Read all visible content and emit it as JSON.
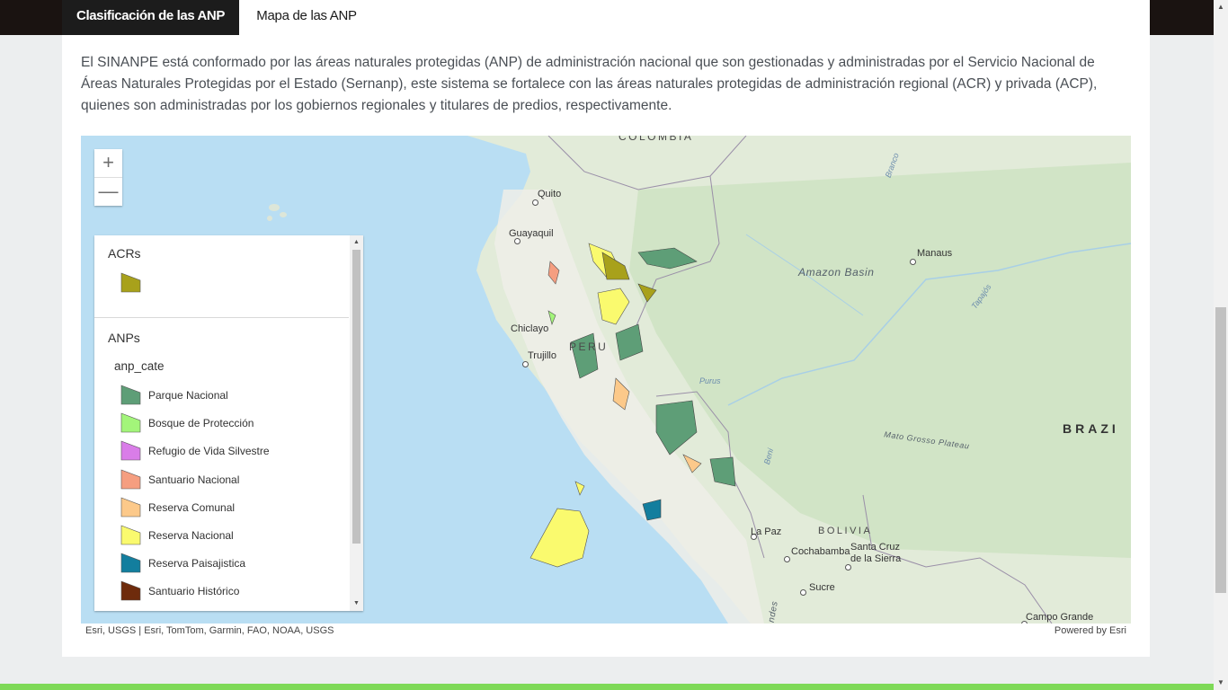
{
  "tabs": [
    {
      "label": "Clasificación de las ANP",
      "active": true
    },
    {
      "label": "Mapa de las ANP",
      "active": false
    }
  ],
  "intro_text": "El SINANPE está conformado por las áreas naturales protegidas (ANP) de administración nacional que son gestionadas y administradas por el Servicio Nacional de Áreas Naturales Protegidas por el Estado (Sernanp), este sistema se fortalece con las áreas naturales protegidas de administración regional (ACR) y privada (ACP), quienes son administradas por los gobiernos regionales y titulares de predios, respectivamente.",
  "map": {
    "zoom_in": "+",
    "zoom_out": "—",
    "labels": {
      "colombia": "COLOMBIA",
      "quito": "Quito",
      "guayaquil": "Guayaquil",
      "chiclayo": "Chiclayo",
      "trujillo": "Trujillo",
      "peru": "PERU",
      "manaus": "Manaus",
      "amazon_basin": "Amazon Basin",
      "brazil": "BRAZI",
      "mato_grosso": "Mato Grosso Plateau",
      "bolivia": "BOLIVIA",
      "la_paz": "La Paz",
      "cochabamba": "Cochabamba",
      "santa_cruz": "Santa Cruz\nde la Sierra",
      "sucre": "Sucre",
      "campo_grande": "Campo Grande",
      "purus": "Purus",
      "branco": "Branco",
      "tapajos": "Tapajós",
      "beni": "Beni",
      "andes": "Andes"
    },
    "attribution": "Esri, USGS | Esri, TomTom, Garmin, FAO, NOAA, USGS",
    "powered_by": "Powered by Esri"
  },
  "legend": {
    "acr_title": "ACRs",
    "anp_title": "ANPs",
    "anp_field": "anp_cate",
    "acr_color": "#a8a11b",
    "items": [
      {
        "label": "Parque Nacional",
        "color": "#5e9e77"
      },
      {
        "label": "Bosque de Protección",
        "color": "#a3f57a"
      },
      {
        "label": "Refugio de Vida Silvestre",
        "color": "#d97de8"
      },
      {
        "label": "Santuario Nacional",
        "color": "#f59e80"
      },
      {
        "label": "Reserva Comunal",
        "color": "#fcc98a"
      },
      {
        "label": "Reserva Nacional",
        "color": "#fafa6e"
      },
      {
        "label": "Reserva Paisajistica",
        "color": "#137e9e"
      },
      {
        "label": "Santuario Histórico",
        "color": "#6e2b0c"
      }
    ]
  }
}
